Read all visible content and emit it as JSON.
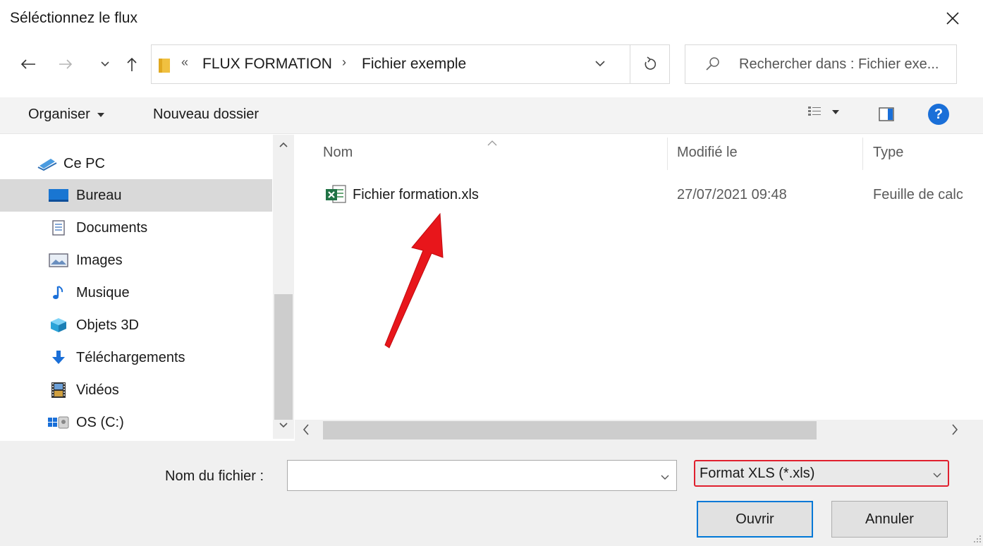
{
  "dialog": {
    "title": "Séléctionnez le flux"
  },
  "address": {
    "overflow": "«",
    "crumbs": [
      "FLUX FORMATION",
      "Fichier exemple"
    ],
    "separator": "›"
  },
  "search": {
    "placeholder": "Rechercher dans : Fichier exe..."
  },
  "toolbar": {
    "organise_label": "Organiser",
    "new_folder_label": "Nouveau dossier",
    "help_glyph": "?"
  },
  "sidebar": {
    "items": [
      {
        "label": "Ce PC",
        "icon": "computer-icon"
      },
      {
        "label": "Bureau",
        "icon": "desktop-icon",
        "selected": true
      },
      {
        "label": "Documents",
        "icon": "documents-icon"
      },
      {
        "label": "Images",
        "icon": "pictures-icon"
      },
      {
        "label": "Musique",
        "icon": "music-icon"
      },
      {
        "label": "Objets 3D",
        "icon": "objects-3d-icon"
      },
      {
        "label": "Téléchargements",
        "icon": "downloads-icon"
      },
      {
        "label": "Vidéos",
        "icon": "videos-icon"
      },
      {
        "label": "OS (C:)",
        "icon": "drive-icon"
      }
    ]
  },
  "columns": {
    "name": "Nom",
    "modified": "Modifié le",
    "type": "Type"
  },
  "files": [
    {
      "name": "Fichier formation.xls",
      "modified": "27/07/2021 09:48",
      "type": "Feuille de calc",
      "icon": "excel-file-icon"
    }
  ],
  "footer": {
    "filename_label": "Nom du fichier :",
    "filename_value": "",
    "filter_value": "Format XLS (*.xls)",
    "open_label": "Ouvrir",
    "cancel_label": "Annuler"
  },
  "colors": {
    "selection": "#d9d9d9",
    "accent": "#0078d7",
    "highlight": "#e0202e",
    "annotation_arrow": "#e8161b"
  }
}
